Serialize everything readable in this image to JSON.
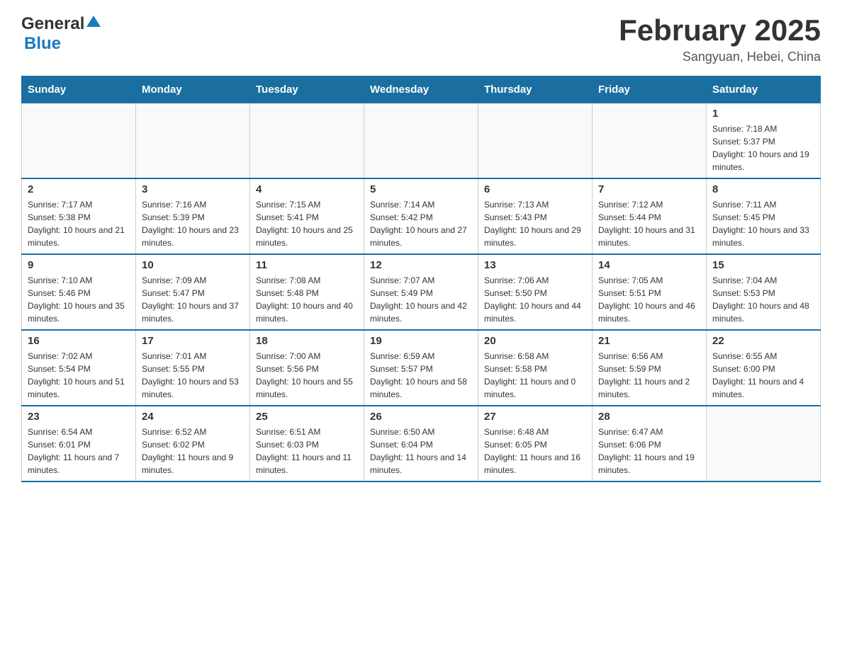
{
  "header": {
    "logo_general": "General",
    "logo_blue": "Blue",
    "month_title": "February 2025",
    "location": "Sangyuan, Hebei, China"
  },
  "weekdays": [
    "Sunday",
    "Monday",
    "Tuesday",
    "Wednesday",
    "Thursday",
    "Friday",
    "Saturday"
  ],
  "weeks": [
    [
      {
        "day": "",
        "sunrise": "",
        "sunset": "",
        "daylight": ""
      },
      {
        "day": "",
        "sunrise": "",
        "sunset": "",
        "daylight": ""
      },
      {
        "day": "",
        "sunrise": "",
        "sunset": "",
        "daylight": ""
      },
      {
        "day": "",
        "sunrise": "",
        "sunset": "",
        "daylight": ""
      },
      {
        "day": "",
        "sunrise": "",
        "sunset": "",
        "daylight": ""
      },
      {
        "day": "",
        "sunrise": "",
        "sunset": "",
        "daylight": ""
      },
      {
        "day": "1",
        "sunrise": "Sunrise: 7:18 AM",
        "sunset": "Sunset: 5:37 PM",
        "daylight": "Daylight: 10 hours and 19 minutes."
      }
    ],
    [
      {
        "day": "2",
        "sunrise": "Sunrise: 7:17 AM",
        "sunset": "Sunset: 5:38 PM",
        "daylight": "Daylight: 10 hours and 21 minutes."
      },
      {
        "day": "3",
        "sunrise": "Sunrise: 7:16 AM",
        "sunset": "Sunset: 5:39 PM",
        "daylight": "Daylight: 10 hours and 23 minutes."
      },
      {
        "day": "4",
        "sunrise": "Sunrise: 7:15 AM",
        "sunset": "Sunset: 5:41 PM",
        "daylight": "Daylight: 10 hours and 25 minutes."
      },
      {
        "day": "5",
        "sunrise": "Sunrise: 7:14 AM",
        "sunset": "Sunset: 5:42 PM",
        "daylight": "Daylight: 10 hours and 27 minutes."
      },
      {
        "day": "6",
        "sunrise": "Sunrise: 7:13 AM",
        "sunset": "Sunset: 5:43 PM",
        "daylight": "Daylight: 10 hours and 29 minutes."
      },
      {
        "day": "7",
        "sunrise": "Sunrise: 7:12 AM",
        "sunset": "Sunset: 5:44 PM",
        "daylight": "Daylight: 10 hours and 31 minutes."
      },
      {
        "day": "8",
        "sunrise": "Sunrise: 7:11 AM",
        "sunset": "Sunset: 5:45 PM",
        "daylight": "Daylight: 10 hours and 33 minutes."
      }
    ],
    [
      {
        "day": "9",
        "sunrise": "Sunrise: 7:10 AM",
        "sunset": "Sunset: 5:46 PM",
        "daylight": "Daylight: 10 hours and 35 minutes."
      },
      {
        "day": "10",
        "sunrise": "Sunrise: 7:09 AM",
        "sunset": "Sunset: 5:47 PM",
        "daylight": "Daylight: 10 hours and 37 minutes."
      },
      {
        "day": "11",
        "sunrise": "Sunrise: 7:08 AM",
        "sunset": "Sunset: 5:48 PM",
        "daylight": "Daylight: 10 hours and 40 minutes."
      },
      {
        "day": "12",
        "sunrise": "Sunrise: 7:07 AM",
        "sunset": "Sunset: 5:49 PM",
        "daylight": "Daylight: 10 hours and 42 minutes."
      },
      {
        "day": "13",
        "sunrise": "Sunrise: 7:06 AM",
        "sunset": "Sunset: 5:50 PM",
        "daylight": "Daylight: 10 hours and 44 minutes."
      },
      {
        "day": "14",
        "sunrise": "Sunrise: 7:05 AM",
        "sunset": "Sunset: 5:51 PM",
        "daylight": "Daylight: 10 hours and 46 minutes."
      },
      {
        "day": "15",
        "sunrise": "Sunrise: 7:04 AM",
        "sunset": "Sunset: 5:53 PM",
        "daylight": "Daylight: 10 hours and 48 minutes."
      }
    ],
    [
      {
        "day": "16",
        "sunrise": "Sunrise: 7:02 AM",
        "sunset": "Sunset: 5:54 PM",
        "daylight": "Daylight: 10 hours and 51 minutes."
      },
      {
        "day": "17",
        "sunrise": "Sunrise: 7:01 AM",
        "sunset": "Sunset: 5:55 PM",
        "daylight": "Daylight: 10 hours and 53 minutes."
      },
      {
        "day": "18",
        "sunrise": "Sunrise: 7:00 AM",
        "sunset": "Sunset: 5:56 PM",
        "daylight": "Daylight: 10 hours and 55 minutes."
      },
      {
        "day": "19",
        "sunrise": "Sunrise: 6:59 AM",
        "sunset": "Sunset: 5:57 PM",
        "daylight": "Daylight: 10 hours and 58 minutes."
      },
      {
        "day": "20",
        "sunrise": "Sunrise: 6:58 AM",
        "sunset": "Sunset: 5:58 PM",
        "daylight": "Daylight: 11 hours and 0 minutes."
      },
      {
        "day": "21",
        "sunrise": "Sunrise: 6:56 AM",
        "sunset": "Sunset: 5:59 PM",
        "daylight": "Daylight: 11 hours and 2 minutes."
      },
      {
        "day": "22",
        "sunrise": "Sunrise: 6:55 AM",
        "sunset": "Sunset: 6:00 PM",
        "daylight": "Daylight: 11 hours and 4 minutes."
      }
    ],
    [
      {
        "day": "23",
        "sunrise": "Sunrise: 6:54 AM",
        "sunset": "Sunset: 6:01 PM",
        "daylight": "Daylight: 11 hours and 7 minutes."
      },
      {
        "day": "24",
        "sunrise": "Sunrise: 6:52 AM",
        "sunset": "Sunset: 6:02 PM",
        "daylight": "Daylight: 11 hours and 9 minutes."
      },
      {
        "day": "25",
        "sunrise": "Sunrise: 6:51 AM",
        "sunset": "Sunset: 6:03 PM",
        "daylight": "Daylight: 11 hours and 11 minutes."
      },
      {
        "day": "26",
        "sunrise": "Sunrise: 6:50 AM",
        "sunset": "Sunset: 6:04 PM",
        "daylight": "Daylight: 11 hours and 14 minutes."
      },
      {
        "day": "27",
        "sunrise": "Sunrise: 6:48 AM",
        "sunset": "Sunset: 6:05 PM",
        "daylight": "Daylight: 11 hours and 16 minutes."
      },
      {
        "day": "28",
        "sunrise": "Sunrise: 6:47 AM",
        "sunset": "Sunset: 6:06 PM",
        "daylight": "Daylight: 11 hours and 19 minutes."
      },
      {
        "day": "",
        "sunrise": "",
        "sunset": "",
        "daylight": ""
      }
    ]
  ]
}
